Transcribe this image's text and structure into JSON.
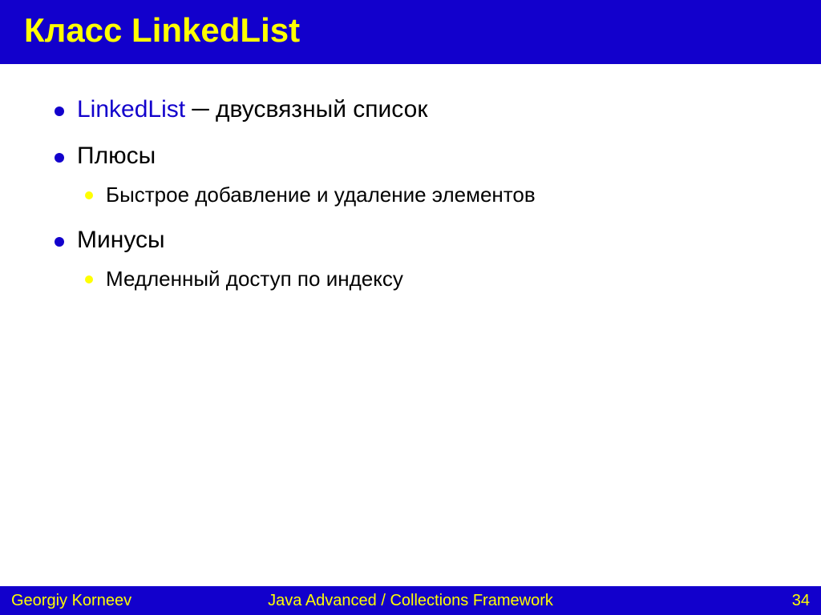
{
  "title": "Класс LinkedList",
  "bullets": {
    "item1_highlight": "LinkedList",
    "item1_rest": " ─ двусвязный список",
    "item2": "Плюсы",
    "item2_sub1": "Быстрое добавление и удаление элементов",
    "item3": "Минусы",
    "item3_sub1": "Медленный доступ по индексу"
  },
  "footer": {
    "author": "Georgiy Korneev",
    "course": "Java Advanced / Collections Framework",
    "page": "34"
  }
}
